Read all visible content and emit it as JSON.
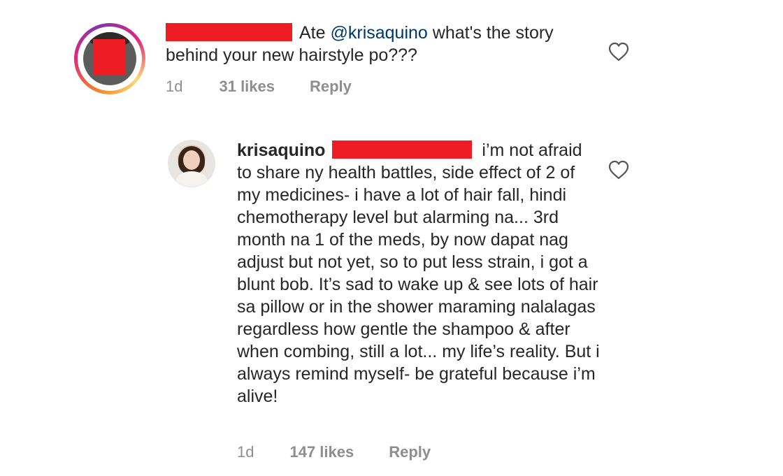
{
  "comments": [
    {
      "username": "",
      "text_prefix": "Ate",
      "mention": "@krisaquino",
      "text_suffix": " what's the story behind your new hairstyle po???",
      "time": "1d",
      "likes": "31 likes",
      "reply_label": "Reply",
      "liked": false,
      "heart_icon": "heart-outline-icon"
    },
    {
      "username": "krisaquino",
      "text": "i’m not afraid to share ny health battles, side effect of 2 of my medicines- i have a lot of hair fall, hindi chemotherapy level but alarming na... 3rd month na 1 of the meds, by now dapat nag adjust but not yet, so to put less strain, i got a blunt bob. It’s sad to wake up & see lots of hair sa pillow or in the shower maraming nalalagas regardless how gentle the shampoo & after when combing, still a lot... my life’s reality. But i always remind myself- be grateful because i’m alive!",
      "time": "1d",
      "likes": "147 likes",
      "reply_label": "Reply",
      "liked": false,
      "heart_icon": "heart-outline-icon"
    }
  ],
  "colors": {
    "text": "#262626",
    "secondary": "#8e8e8e",
    "mention": "#00376b",
    "redaction": "#ee1c24"
  }
}
